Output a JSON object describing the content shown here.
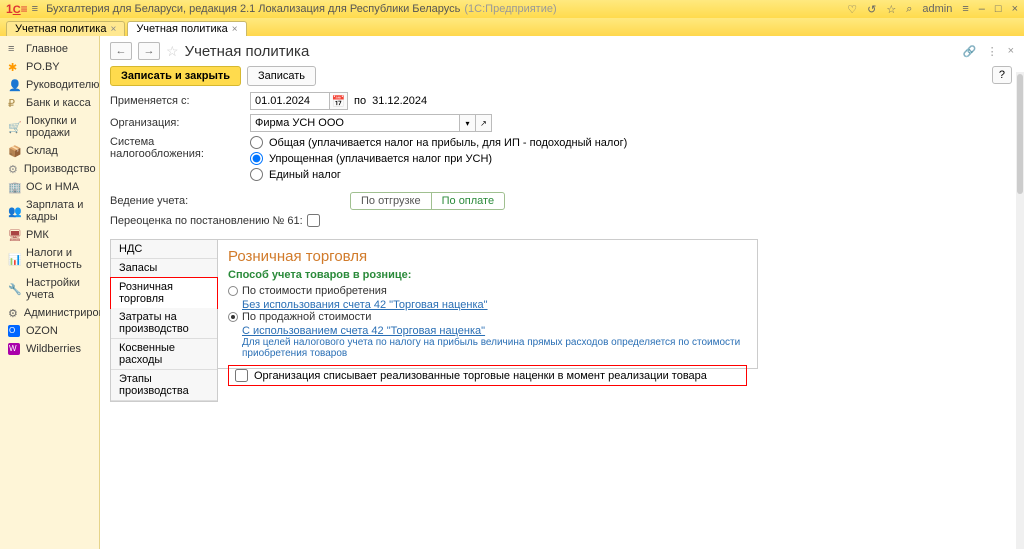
{
  "titlebar": {
    "logo": "1С",
    "app": "Бухгалтерия для Беларуси, редакция 2.1 Локализация для Республики Беларусь",
    "suffix": "(1С:Предприятие)",
    "user": "admin"
  },
  "tabs": {
    "t1": "Учетная политика",
    "t2": "Учетная политика"
  },
  "sidebar": {
    "main": "Главное",
    "poby": "PO.BY",
    "ruk": "Руководителю",
    "bank": "Банк и касса",
    "pokupki": "Покупки и продажи",
    "sklad": "Склад",
    "proizv": "Производство",
    "os": "ОС и НМА",
    "zp": "Зарплата и кадры",
    "rmk": "РМК",
    "nalogi": "Налоги и отчетность",
    "nastr": "Настройки учета",
    "admin": "Администрирование",
    "ozon": "OZON",
    "wb": "Wildberries"
  },
  "page": {
    "title": "Учетная политика",
    "save_close": "Записать и закрыть",
    "save": "Записать",
    "help": "?",
    "applies": "Применяется с:",
    "date": "01.01.2024",
    "po": "по",
    "date_end": "31.12.2024",
    "org_label": "Организация:",
    "org_value": "Фирма УСН ООО",
    "tax_label": "Система налогообложения:",
    "tax_opt1": "Общая (уплачивается налог на прибыль, для ИП - подоходный налог)",
    "tax_opt2": "Упрощенная (уплачивается налог при УСН)",
    "tax_opt3": "Единый налог",
    "vedenie": "Ведение учета:",
    "seg1": "По отгрузке",
    "seg2": "По оплате",
    "pereoc": "Переоценка по постановлению № 61:"
  },
  "vtabs": {
    "nds": "НДС",
    "zapasy": "Запасы",
    "rozn": "Розничная торговля",
    "zatraty": "Затраты на производство",
    "kosv": "Косвенные расходы",
    "etapy": "Этапы производства"
  },
  "panel": {
    "title": "Розничная торговля",
    "sub": "Способ учета товаров в рознице:",
    "opt1": "По стоимости приобретения",
    "link1": "Без использования счета 42 \"Торговая наценка\"",
    "opt2": "По продажной стоимости",
    "link2": "С использованием счета 42 \"Торговая наценка\"",
    "note": "Для целей налогового учета по налогу на прибыль величина прямых расходов определяется по стоимости приобретения товаров",
    "check": "Организация списывает реализованные торговые наценки в момент реализации товара"
  }
}
